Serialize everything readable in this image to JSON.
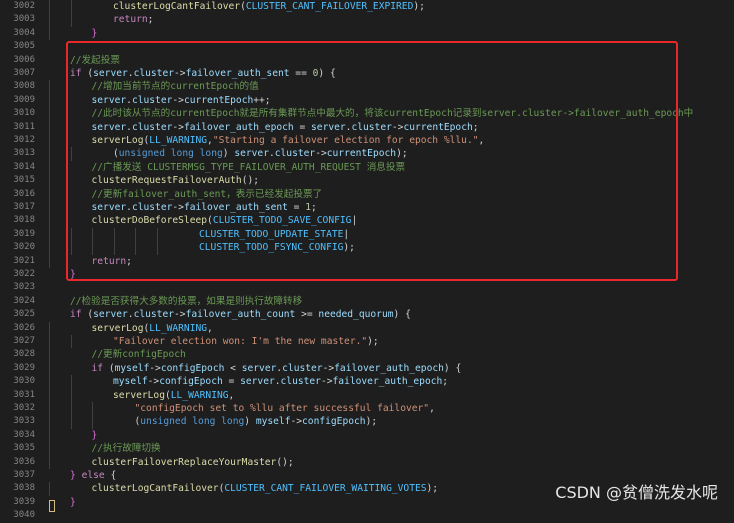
{
  "editor": {
    "lines": [
      {
        "n": "3002",
        "indent": 2,
        "tokens": [
          {
            "t": "clusterLogCantFailover",
            "c": "fn"
          },
          {
            "t": "(",
            "c": "plain"
          },
          {
            "t": "CLUSTER_CANT_FAILOVER_EXPIRED",
            "c": "const"
          },
          {
            "t": ");",
            "c": "plain"
          }
        ]
      },
      {
        "n": "3003",
        "indent": 2,
        "tokens": [
          {
            "t": "return",
            "c": "kw"
          },
          {
            "t": ";",
            "c": "plain"
          }
        ]
      },
      {
        "n": "3004",
        "indent": 1,
        "tokens": [
          {
            "t": "}",
            "c": "brace"
          }
        ]
      },
      {
        "n": "3005",
        "indent": 0,
        "tokens": []
      },
      {
        "n": "3006",
        "indent": 0,
        "tokens": [
          {
            "t": "//发起投票",
            "c": "comment"
          }
        ]
      },
      {
        "n": "3007",
        "indent": 0,
        "tokens": [
          {
            "t": "if",
            "c": "kw"
          },
          {
            "t": " (",
            "c": "plain"
          },
          {
            "t": "server",
            "c": "var"
          },
          {
            "t": ".",
            "c": "plain"
          },
          {
            "t": "cluster",
            "c": "var"
          },
          {
            "t": "->",
            "c": "plain"
          },
          {
            "t": "failover_auth_sent",
            "c": "var"
          },
          {
            "t": " == ",
            "c": "plain"
          },
          {
            "t": "0",
            "c": "num"
          },
          {
            "t": ") {",
            "c": "plain"
          }
        ]
      },
      {
        "n": "3008",
        "indent": 1,
        "tokens": [
          {
            "t": "//增加当前节点的currentEpoch的值",
            "c": "comment"
          }
        ]
      },
      {
        "n": "3009",
        "indent": 1,
        "tokens": [
          {
            "t": "server",
            "c": "var"
          },
          {
            "t": ".",
            "c": "plain"
          },
          {
            "t": "cluster",
            "c": "var"
          },
          {
            "t": "->",
            "c": "plain"
          },
          {
            "t": "currentEpoch",
            "c": "var"
          },
          {
            "t": "++;",
            "c": "plain"
          }
        ]
      },
      {
        "n": "3010",
        "indent": 1,
        "tokens": [
          {
            "t": "//此时该从节点的currentEpoch就是所有集群节点中最大的，将该currentEpoch记录到server.cluster->failover_auth_epoch中",
            "c": "comment"
          }
        ]
      },
      {
        "n": "3011",
        "indent": 1,
        "tokens": [
          {
            "t": "server",
            "c": "var"
          },
          {
            "t": ".",
            "c": "plain"
          },
          {
            "t": "cluster",
            "c": "var"
          },
          {
            "t": "->",
            "c": "plain"
          },
          {
            "t": "failover_auth_epoch",
            "c": "var"
          },
          {
            "t": " = ",
            "c": "plain"
          },
          {
            "t": "server",
            "c": "var"
          },
          {
            "t": ".",
            "c": "plain"
          },
          {
            "t": "cluster",
            "c": "var"
          },
          {
            "t": "->",
            "c": "plain"
          },
          {
            "t": "currentEpoch",
            "c": "var"
          },
          {
            "t": ";",
            "c": "plain"
          }
        ]
      },
      {
        "n": "3012",
        "indent": 1,
        "tokens": [
          {
            "t": "serverLog",
            "c": "fn"
          },
          {
            "t": "(",
            "c": "plain"
          },
          {
            "t": "LL_WARNING",
            "c": "const"
          },
          {
            "t": ",",
            "c": "plain"
          },
          {
            "t": "\"Starting a failover election for epoch %llu.\"",
            "c": "str"
          },
          {
            "t": ",",
            "c": "plain"
          }
        ]
      },
      {
        "n": "3013",
        "indent": 2,
        "tokens": [
          {
            "t": "(",
            "c": "plain"
          },
          {
            "t": "unsigned long long",
            "c": "type"
          },
          {
            "t": ") ",
            "c": "plain"
          },
          {
            "t": "server",
            "c": "var"
          },
          {
            "t": ".",
            "c": "plain"
          },
          {
            "t": "cluster",
            "c": "var"
          },
          {
            "t": "->",
            "c": "plain"
          },
          {
            "t": "currentEpoch",
            "c": "var"
          },
          {
            "t": ");",
            "c": "plain"
          }
        ]
      },
      {
        "n": "3014",
        "indent": 1,
        "tokens": [
          {
            "t": "//广播发送 CLUSTERMSG_TYPE_FAILOVER_AUTH_REQUEST 消息投票",
            "c": "comment"
          }
        ]
      },
      {
        "n": "3015",
        "indent": 1,
        "tokens": [
          {
            "t": "clusterRequestFailoverAuth",
            "c": "fn"
          },
          {
            "t": "();",
            "c": "plain"
          }
        ]
      },
      {
        "n": "3016",
        "indent": 1,
        "tokens": [
          {
            "t": "//更新failover_auth_sent，表示已经发起投票了",
            "c": "comment"
          }
        ]
      },
      {
        "n": "3017",
        "indent": 1,
        "tokens": [
          {
            "t": "server",
            "c": "var"
          },
          {
            "t": ".",
            "c": "plain"
          },
          {
            "t": "cluster",
            "c": "var"
          },
          {
            "t": "->",
            "c": "plain"
          },
          {
            "t": "failover_auth_sent",
            "c": "var"
          },
          {
            "t": " = ",
            "c": "plain"
          },
          {
            "t": "1",
            "c": "num"
          },
          {
            "t": ";",
            "c": "plain"
          }
        ]
      },
      {
        "n": "3018",
        "indent": 1,
        "tokens": [
          {
            "t": "clusterDoBeforeSleep",
            "c": "fn"
          },
          {
            "t": "(",
            "c": "plain"
          },
          {
            "t": "CLUSTER_TODO_SAVE_CONFIG",
            "c": "const"
          },
          {
            "t": "|",
            "c": "plain"
          }
        ]
      },
      {
        "n": "3019",
        "indent": 6,
        "tokens": [
          {
            "t": "CLUSTER_TODO_UPDATE_STATE",
            "c": "const"
          },
          {
            "t": "|",
            "c": "plain"
          }
        ]
      },
      {
        "n": "3020",
        "indent": 6,
        "tokens": [
          {
            "t": "CLUSTER_TODO_FSYNC_CONFIG",
            "c": "const"
          },
          {
            "t": ");",
            "c": "plain"
          }
        ]
      },
      {
        "n": "3021",
        "indent": 1,
        "tokens": [
          {
            "t": "return",
            "c": "kw"
          },
          {
            "t": ";",
            "c": "plain"
          }
        ]
      },
      {
        "n": "3022",
        "indent": 0,
        "tokens": [
          {
            "t": "}",
            "c": "brace"
          }
        ]
      },
      {
        "n": "3023",
        "indent": 0,
        "tokens": []
      },
      {
        "n": "3024",
        "indent": 0,
        "tokens": [
          {
            "t": "//检验是否获得大多数的投票，如果是则执行故障转移",
            "c": "comment"
          }
        ]
      },
      {
        "n": "3025",
        "indent": 0,
        "tokens": [
          {
            "t": "if",
            "c": "kw"
          },
          {
            "t": " (",
            "c": "plain"
          },
          {
            "t": "server",
            "c": "var"
          },
          {
            "t": ".",
            "c": "plain"
          },
          {
            "t": "cluster",
            "c": "var"
          },
          {
            "t": "->",
            "c": "plain"
          },
          {
            "t": "failover_auth_count",
            "c": "var"
          },
          {
            "t": " >= ",
            "c": "plain"
          },
          {
            "t": "needed_quorum",
            "c": "var"
          },
          {
            "t": ") {",
            "c": "plain"
          }
        ]
      },
      {
        "n": "3026",
        "indent": 1,
        "tokens": [
          {
            "t": "serverLog",
            "c": "fn"
          },
          {
            "t": "(",
            "c": "plain"
          },
          {
            "t": "LL_WARNING",
            "c": "const"
          },
          {
            "t": ",",
            "c": "plain"
          }
        ]
      },
      {
        "n": "3027",
        "indent": 2,
        "tokens": [
          {
            "t": "\"Failover election won: I'm the new master.\"",
            "c": "str"
          },
          {
            "t": ");",
            "c": "plain"
          }
        ]
      },
      {
        "n": "3028",
        "indent": 1,
        "tokens": [
          {
            "t": "//更新configEpoch",
            "c": "comment"
          }
        ]
      },
      {
        "n": "3029",
        "indent": 1,
        "tokens": [
          {
            "t": "if",
            "c": "kw"
          },
          {
            "t": " (",
            "c": "plain"
          },
          {
            "t": "myself",
            "c": "var"
          },
          {
            "t": "->",
            "c": "plain"
          },
          {
            "t": "configEpoch",
            "c": "var"
          },
          {
            "t": " < ",
            "c": "plain"
          },
          {
            "t": "server",
            "c": "var"
          },
          {
            "t": ".",
            "c": "plain"
          },
          {
            "t": "cluster",
            "c": "var"
          },
          {
            "t": "->",
            "c": "plain"
          },
          {
            "t": "failover_auth_epoch",
            "c": "var"
          },
          {
            "t": ") {",
            "c": "plain"
          }
        ]
      },
      {
        "n": "3030",
        "indent": 2,
        "tokens": [
          {
            "t": "myself",
            "c": "var"
          },
          {
            "t": "->",
            "c": "plain"
          },
          {
            "t": "configEpoch",
            "c": "var"
          },
          {
            "t": " = ",
            "c": "plain"
          },
          {
            "t": "server",
            "c": "var"
          },
          {
            "t": ".",
            "c": "plain"
          },
          {
            "t": "cluster",
            "c": "var"
          },
          {
            "t": "->",
            "c": "plain"
          },
          {
            "t": "failover_auth_epoch",
            "c": "var"
          },
          {
            "t": ";",
            "c": "plain"
          }
        ]
      },
      {
        "n": "3031",
        "indent": 2,
        "tokens": [
          {
            "t": "serverLog",
            "c": "fn"
          },
          {
            "t": "(",
            "c": "plain"
          },
          {
            "t": "LL_WARNING",
            "c": "const"
          },
          {
            "t": ",",
            "c": "plain"
          }
        ]
      },
      {
        "n": "3032",
        "indent": 3,
        "tokens": [
          {
            "t": "\"configEpoch set to %llu after successful failover\"",
            "c": "str"
          },
          {
            "t": ",",
            "c": "plain"
          }
        ]
      },
      {
        "n": "3033",
        "indent": 3,
        "tokens": [
          {
            "t": "(",
            "c": "plain"
          },
          {
            "t": "unsigned long long",
            "c": "type"
          },
          {
            "t": ") ",
            "c": "plain"
          },
          {
            "t": "myself",
            "c": "var"
          },
          {
            "t": "->",
            "c": "plain"
          },
          {
            "t": "configEpoch",
            "c": "var"
          },
          {
            "t": ");",
            "c": "plain"
          }
        ]
      },
      {
        "n": "3034",
        "indent": 1,
        "tokens": [
          {
            "t": "}",
            "c": "brace"
          }
        ]
      },
      {
        "n": "3035",
        "indent": 1,
        "tokens": [
          {
            "t": "//执行故障切换",
            "c": "comment"
          }
        ]
      },
      {
        "n": "3036",
        "indent": 1,
        "tokens": [
          {
            "t": "clusterFailoverReplaceYourMaster",
            "c": "fn"
          },
          {
            "t": "();",
            "c": "plain"
          }
        ]
      },
      {
        "n": "3037",
        "indent": 0,
        "tokens": [
          {
            "t": "} ",
            "c": "brace"
          },
          {
            "t": "else",
            "c": "kw"
          },
          {
            "t": " {",
            "c": "plain"
          }
        ]
      },
      {
        "n": "3038",
        "indent": 1,
        "tokens": [
          {
            "t": "clusterLogCantFailover",
            "c": "fn"
          },
          {
            "t": "(",
            "c": "plain"
          },
          {
            "t": "CLUSTER_CANT_FAILOVER_WAITING_VOTES",
            "c": "const"
          },
          {
            "t": ");",
            "c": "plain"
          }
        ]
      },
      {
        "n": "3039",
        "indent": 0,
        "tokens": [
          {
            "t": "}",
            "c": "brace"
          }
        ]
      },
      {
        "n": "3040",
        "indent": 0,
        "tokens": []
      }
    ]
  },
  "watermark": "CSDN @贫僧洗发水呢",
  "colors": {
    "background": "#1e1e1e",
    "highlight_border": "#e8282b",
    "comment": "#6a9955",
    "function": "#dcdcaa",
    "variable": "#9cdcfe",
    "keyword": "#c586c0",
    "constant": "#4fc1ff",
    "string": "#ce9178",
    "number": "#b5cea8"
  }
}
